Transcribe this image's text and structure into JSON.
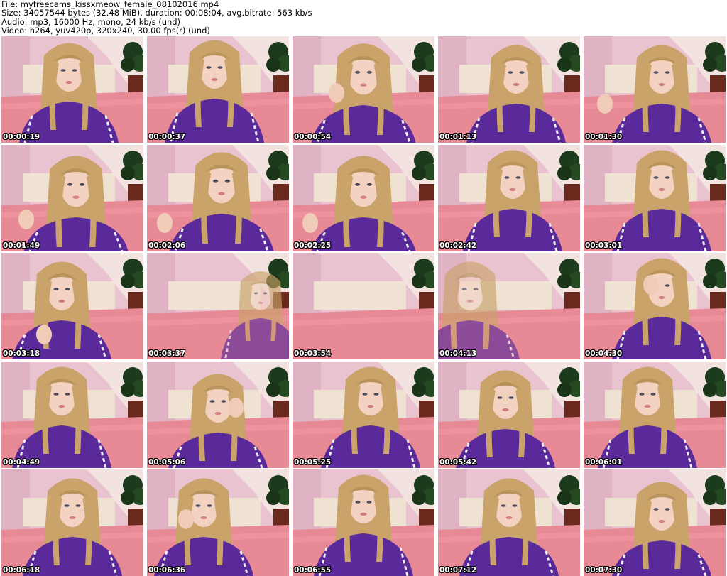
{
  "header": {
    "file_line": "File: myfreecams_kissxmeow_female_08102016.mp4",
    "size_line": "Size: 34057544 bytes (32.48 MiB), duration: 00:08:04, avg.bitrate: 563 kb/s",
    "audio_line": "Audio: mp3, 16000 Hz, mono, 24 kb/s (und)",
    "video_line": "Video: h264, yuv420p, 320x240, 30.00 fps(r) (und)"
  },
  "colors": {
    "background": "#ffffff",
    "wall": "#e9c3cf",
    "bed": "#e88a96",
    "hoodie": "#5a2a9a",
    "hair": "#c9a36a",
    "timestamp_text": "#ffffff",
    "timestamp_outline": "#000000"
  },
  "thumbnails": [
    {
      "timestamp": "00:00:19"
    },
    {
      "timestamp": "00:00:37"
    },
    {
      "timestamp": "00:00:54"
    },
    {
      "timestamp": "00:01:13"
    },
    {
      "timestamp": "00:01:30"
    },
    {
      "timestamp": "00:01:49"
    },
    {
      "timestamp": "00:02:06"
    },
    {
      "timestamp": "00:02:25"
    },
    {
      "timestamp": "00:02:42"
    },
    {
      "timestamp": "00:03:01"
    },
    {
      "timestamp": "00:03:18"
    },
    {
      "timestamp": "00:03:37"
    },
    {
      "timestamp": "00:03:54"
    },
    {
      "timestamp": "00:04:13"
    },
    {
      "timestamp": "00:04:30"
    },
    {
      "timestamp": "00:04:49"
    },
    {
      "timestamp": "00:05:06"
    },
    {
      "timestamp": "00:05:25"
    },
    {
      "timestamp": "00:05:42"
    },
    {
      "timestamp": "00:06:01"
    },
    {
      "timestamp": "00:06:18"
    },
    {
      "timestamp": "00:06:36"
    },
    {
      "timestamp": "00:06:55"
    },
    {
      "timestamp": "00:07:12"
    },
    {
      "timestamp": "00:07:30"
    }
  ]
}
